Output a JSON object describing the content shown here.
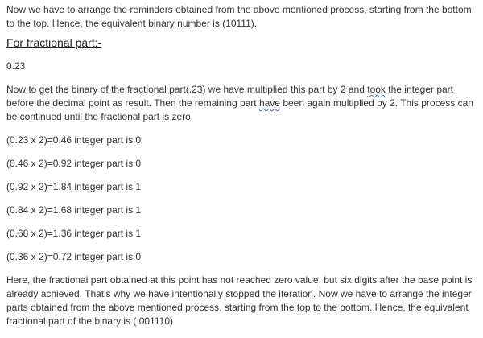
{
  "intro": "Now we have to arrange the reminders obtained from the above mentioned process, starting from the bottom to the top. Hence, the equivalent binary number is (10111).",
  "heading": "For fractional part:-",
  "fraction_value": "0.23",
  "explanation": {
    "part1": "Now to get the binary of the fractional part(.23) we have multiplied this part by 2 and ",
    "took": "took",
    "part2": " the integer part before the decimal point as result. Then the remaining part ",
    "have": "have",
    "part3": " been again multiplied by 2. This process can be continued until the fractional part is zero."
  },
  "steps": [
    "(0.23 x 2)=0.46 integer part is 0",
    "(0.46 x 2)=0.92 integer part is 0",
    "(0.92 x 2)=1.84 integer part is 1",
    "(0.84 x 2)=1.68 integer part is 1",
    "(0.68 x 2)=1.36 integer part is 1",
    "(0.36 x 2)=0.72 integer part is 0"
  ],
  "conclusion": "Here, the fractional part obtained at this point has not reached zero value, but six digits after the base point is already achieved. That's why we have intentionally stopped the iteration. Now we have to arrange the integer parts obtained from the above mentioned process, starting from the top to the bottom. Hence, the equivalent fractional part of the binary is (.001110)"
}
